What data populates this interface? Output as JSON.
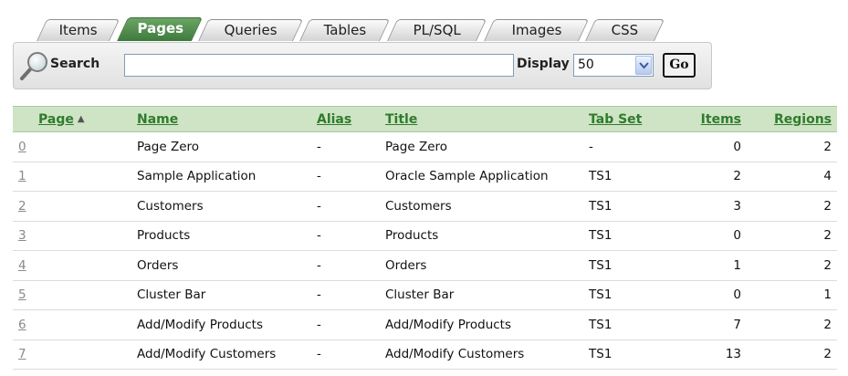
{
  "tabs": [
    {
      "label": "Items",
      "active": false
    },
    {
      "label": "Pages",
      "active": true
    },
    {
      "label": "Queries",
      "active": false
    },
    {
      "label": "Tables",
      "active": false
    },
    {
      "label": "PL/SQL",
      "active": false
    },
    {
      "label": "Images",
      "active": false
    },
    {
      "label": "CSS",
      "active": false
    }
  ],
  "search": {
    "label": "Search",
    "value": "",
    "display_label": "Display",
    "display_value": "50",
    "go_label": "Go"
  },
  "report": {
    "columns": [
      "Page",
      "Name",
      "Alias",
      "Title",
      "Tab Set",
      "Items",
      "Regions"
    ],
    "sort_indicator": "▲",
    "rows": [
      [
        "0",
        "Page Zero",
        "-",
        "Page Zero",
        "-",
        "0",
        "2"
      ],
      [
        "1",
        "Sample Application",
        "-",
        "Oracle Sample Application",
        "TS1",
        "2",
        "4"
      ],
      [
        "2",
        "Customers",
        "-",
        "Customers",
        "TS1",
        "3",
        "2"
      ],
      [
        "3",
        "Products",
        "-",
        "Products",
        "TS1",
        "0",
        "2"
      ],
      [
        "4",
        "Orders",
        "-",
        "Orders",
        "TS1",
        "1",
        "2"
      ],
      [
        "5",
        "Cluster Bar",
        "-",
        "Cluster Bar",
        "TS1",
        "0",
        "1"
      ],
      [
        "6",
        "Add/Modify Products",
        "-",
        "Add/Modify Products",
        "TS1",
        "7",
        "2"
      ],
      [
        "7",
        "Add/Modify Customers",
        "-",
        "Add/Modify Customers",
        "TS1",
        "13",
        "2"
      ]
    ]
  },
  "colors": {
    "accent_green": "#3e7a3c",
    "header_bg": "#cfe4c5",
    "header_link": "#2f7c2c"
  }
}
